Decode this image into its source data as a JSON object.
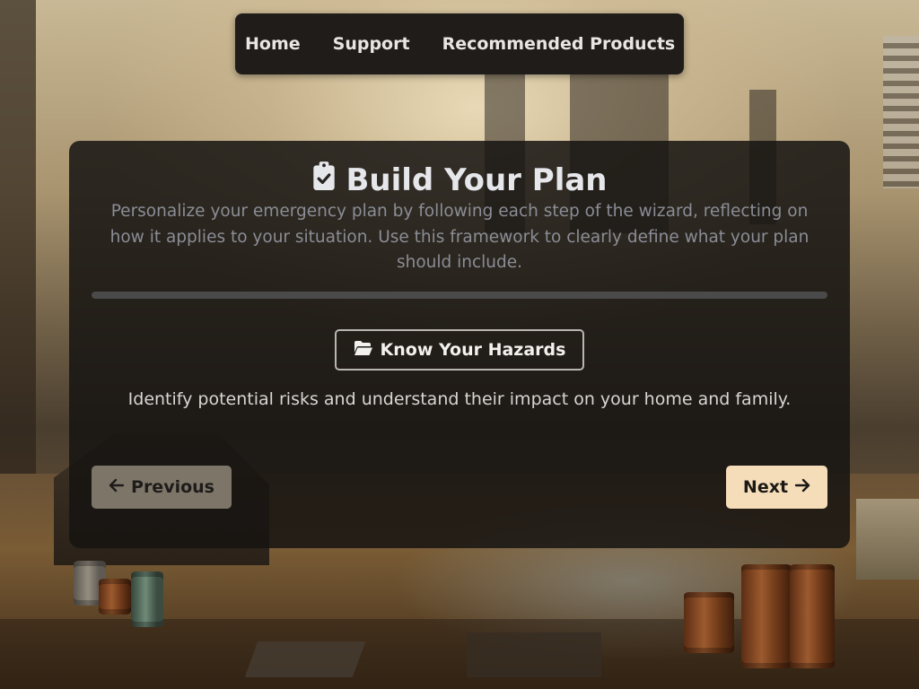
{
  "nav": {
    "items": [
      {
        "label": "Home"
      },
      {
        "label": "Support"
      },
      {
        "label": "Recommended Products"
      }
    ]
  },
  "wizard": {
    "title": "Build Your Plan",
    "title_icon": "clipboard-check-icon",
    "subtitle": "Personalize your emergency plan by following each step of the wizard, reflecting on how it applies to your situation. Use this framework to clearly define what your plan should include.",
    "progress_percent": 0,
    "step": {
      "icon": "folder-open-icon",
      "label": "Know Your Hazards",
      "description": "Identify potential risks and understand their impact on your home and family."
    },
    "prev_label": "Previous",
    "prev_icon": "arrow-left-icon",
    "next_label": "Next",
    "next_icon": "arrow-right-icon"
  },
  "colors": {
    "nav_bg": "#1f1c1a",
    "card_bg": "#161412",
    "prev_btn": "#7d7568",
    "next_btn": "#f6ddb9",
    "subtitle_text": "#8b8d96"
  }
}
